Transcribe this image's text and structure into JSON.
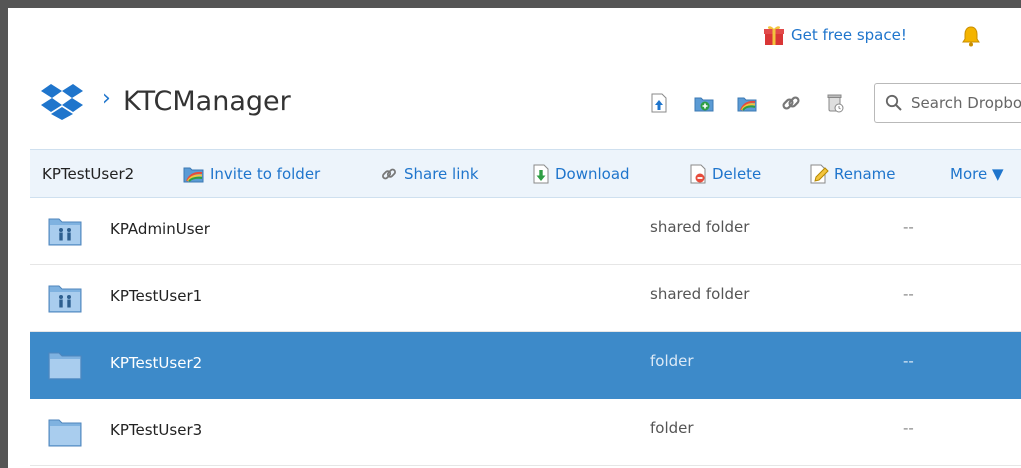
{
  "promo": {
    "label": "Get free space!"
  },
  "header": {
    "separator": "›",
    "title": "KTCManager"
  },
  "search": {
    "placeholder": "Search Dropbox"
  },
  "actionbar": {
    "selected": "KPTestUser2",
    "invite": "Invite to folder",
    "share": "Share link",
    "download": "Download",
    "delete": "Delete",
    "rename": "Rename",
    "more": "More ▼"
  },
  "files": [
    {
      "name": "KPAdminUser",
      "type": "shared folder",
      "modified": "--",
      "icon": "shared-folder-icon",
      "selected": false
    },
    {
      "name": "KPTestUser1",
      "type": "shared folder",
      "modified": "--",
      "icon": "shared-folder-icon",
      "selected": false
    },
    {
      "name": "KPTestUser2",
      "type": "folder",
      "modified": "--",
      "icon": "folder-icon",
      "selected": true
    },
    {
      "name": "KPTestUser3",
      "type": "folder",
      "modified": "--",
      "icon": "folder-icon",
      "selected": false
    }
  ],
  "colors": {
    "link": "#1f75cc",
    "selection": "#3d8ac9",
    "actionbar": "#edf4fb"
  }
}
